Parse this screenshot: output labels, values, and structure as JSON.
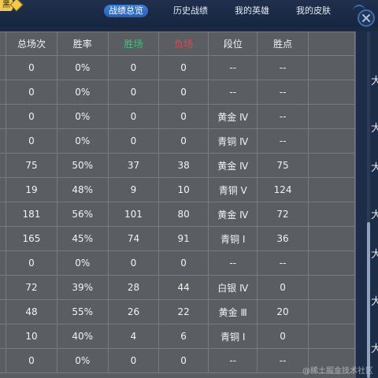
{
  "top": {
    "corner_label": "黑",
    "tabs": [
      {
        "label": "战绩总览",
        "active": true
      },
      {
        "label": "历史战绩",
        "active": false
      },
      {
        "label": "我的英雄",
        "active": false
      },
      {
        "label": "我的皮肤",
        "active": false
      }
    ]
  },
  "table": {
    "headers": [
      "总场次",
      "胜率",
      "胜场",
      "负场",
      "段位",
      "胜点"
    ],
    "rows": [
      [
        "0",
        "0%",
        "0",
        "0",
        "--",
        "--"
      ],
      [
        "0",
        "0%",
        "0",
        "0",
        "--",
        "--"
      ],
      [
        "0",
        "0%",
        "0",
        "0",
        "黄金 Ⅳ",
        "--"
      ],
      [
        "0",
        "0%",
        "0",
        "0",
        "青铜 Ⅳ",
        "--"
      ],
      [
        "75",
        "50%",
        "37",
        "38",
        "黄金 Ⅳ",
        "75"
      ],
      [
        "19",
        "48%",
        "9",
        "10",
        "青铜 Ⅴ",
        "124"
      ],
      [
        "181",
        "56%",
        "101",
        "80",
        "黄金 Ⅳ",
        "72"
      ],
      [
        "165",
        "45%",
        "74",
        "91",
        "青铜 Ⅰ",
        "36"
      ],
      [
        "0",
        "0%",
        "0",
        "0",
        "--",
        "--"
      ],
      [
        "72",
        "39%",
        "28",
        "44",
        "白银 Ⅳ",
        "0"
      ],
      [
        "48",
        "55%",
        "26",
        "22",
        "黄金 Ⅲ",
        "20"
      ],
      [
        "10",
        "40%",
        "4",
        "6",
        "青铜 Ⅰ",
        "0"
      ],
      [
        "0",
        "0%",
        "0",
        "0",
        "--",
        "--"
      ]
    ]
  },
  "edge_glyph": "大",
  "watermark": "@稀土掘金技术社区",
  "colors": {
    "win_header": "#3cc47c",
    "lose_header": "#e04848",
    "active_tab": "#3d7fd6",
    "panel_bg": "#5a5e63"
  }
}
